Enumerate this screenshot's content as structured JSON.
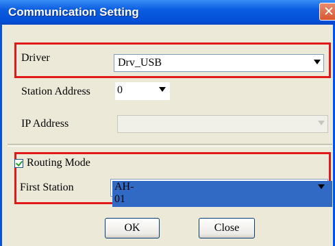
{
  "window": {
    "title": "Communication Setting",
    "close_glyph": "✕"
  },
  "driver": {
    "label": "Driver",
    "value": "Drv_USB"
  },
  "station_address": {
    "label": "Station Address",
    "value": "0"
  },
  "ip_address": {
    "label": "IP Address",
    "value": ""
  },
  "routing_mode": {
    "label": "Routing Mode",
    "checked": true
  },
  "first_station": {
    "label": "First Station",
    "value": "AH-01"
  },
  "buttons": {
    "ok": "OK",
    "close": "Close"
  },
  "colors": {
    "highlight_border": "#e01818",
    "title_blue": "#0a5ce0",
    "selection": "#316ac5"
  }
}
